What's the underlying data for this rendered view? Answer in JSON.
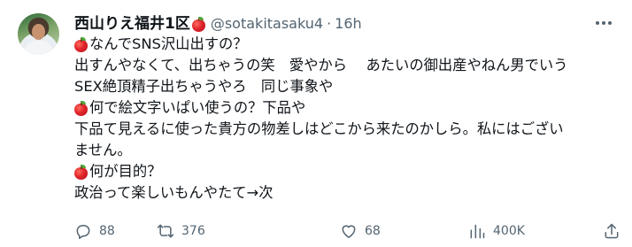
{
  "tweet": {
    "author": {
      "display_name": "西山りえ福井1区",
      "handle": "@sotakitasaku4",
      "separator": "·",
      "time": "16h"
    },
    "lines": [
      {
        "icon": "apple-emoji",
        "text": "なんでSNS沢山出すの？"
      },
      {
        "icon": null,
        "text": "出すんやなくて、出ちゃうの笑　愛やから　 あたいの御出産やねん男でいう"
      },
      {
        "icon": null,
        "text": "SEX絶頂精子出ちゃうやろ　同じ事象や"
      },
      {
        "icon": "apple-emoji",
        "text": "何で絵文字いぱい使うの？下品や"
      },
      {
        "icon": null,
        "text": "下品て見えるに使った貴方の物差しはどこから来たのかしら。私にはござい"
      },
      {
        "icon": null,
        "text": "ません。"
      },
      {
        "icon": "apple-emoji",
        "text": "何が目的？"
      },
      {
        "icon": null,
        "text": "政治って楽しいもんやたて→次"
      }
    ],
    "actions": {
      "reply": {
        "icon": "reply-icon",
        "count": "88"
      },
      "retweet": {
        "icon": "retweet-icon",
        "count": "376"
      },
      "like": {
        "icon": "heart-icon",
        "count": "68"
      },
      "views": {
        "icon": "views-icon",
        "count": "400K"
      },
      "share": {
        "icon": "share-icon"
      }
    }
  },
  "colors": {
    "text": "#0f1419",
    "secondary": "#536471",
    "background": "#ffffff"
  }
}
